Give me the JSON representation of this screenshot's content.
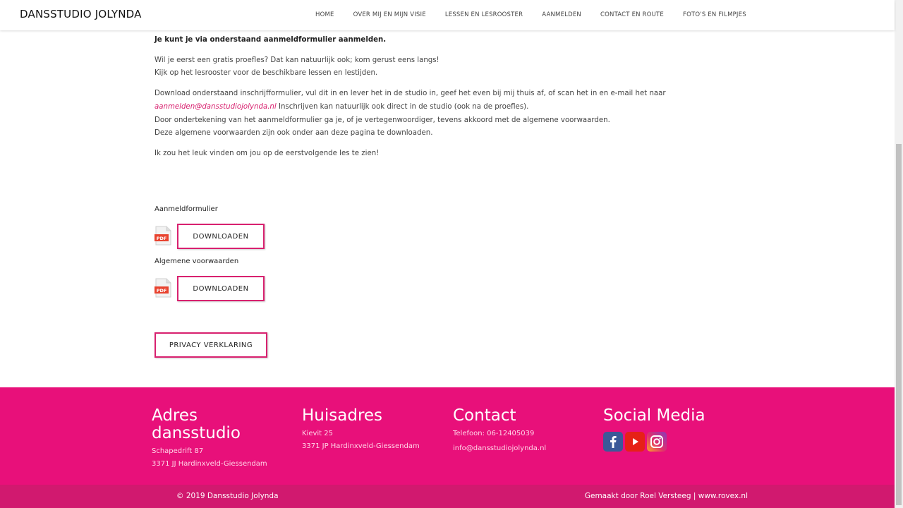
{
  "header": {
    "brand": "DANSSTUDIO JOLYNDA",
    "nav": [
      "HOME",
      "OVER MIJ EN MIJN VISIE",
      "LESSEN EN LESROOSTER",
      "AANMELDEN",
      "CONTACT EN ROUTE",
      "FOTO'S EN FILMPJES"
    ]
  },
  "content": {
    "lead": "Je kunt je via onderstaand aanmeldformulier aanmelden.",
    "p2_line1": "Wil je eerst een gratis proefles? Dat kan natuurlijk ook; kom gerust eens langs!",
    "p2_line2": "Kijk op het lesrooster voor de beschikbare lessen en lestijden.",
    "p3_line1": "Download onderstaand inschrijfformulier, vul dit in en lever het in de studio in, geef het even bij mij thuis af, of scan het in en e-mail het naar",
    "p3_email": "aanmelden@dansstudiojolynda.nl",
    "p3_line2_rest": " Inschrijven kan natuurlijk ook direct in de studio (ook na de proefles).",
    "p3_line3": "Door ondertekening van het aanmeldformulier ga je, of je vertegenwoordiger, tevens akkoord met de algemene voorwaarden.",
    "p3_line4": "Deze algemene voorwaarden zijn ook onder aan deze pagina te downloaden.",
    "p4": "Ik zou het leuk vinden om jou op de eerstvolgende les te zien!"
  },
  "downloads": [
    {
      "label": "Aanmeldformulier",
      "button": "DOWNLOADEN",
      "icon_text": "PDF"
    },
    {
      "label": "Algemene voorwaarden",
      "button": "DOWNLOADEN",
      "icon_text": "PDF"
    }
  ],
  "privacy_button": "PRIVACY VERKLARING",
  "footer": {
    "address_title_1": "Adres",
    "address_title_2": "dansstudio",
    "address_line1": "Schapedrift 87",
    "address_line2": "3371 JJ Hardinxveld-Giessendam",
    "home_title": "Huisadres",
    "home_line1": "Kievit 25",
    "home_line2": "3371 JP Hardinxveld-Giessendam",
    "contact_title": "Contact",
    "contact_phone": "Telefoon: 06-12405039",
    "contact_email": "info@dansstudiojolynda.nl",
    "social_title": "Social Media",
    "social_icons": [
      "facebook-icon",
      "youtube-icon",
      "instagram-icon"
    ]
  },
  "bottombar": {
    "copyright": "© 2019 Dansstudio Jolynda",
    "credit": "Gemaakt door Roel Versteeg | www.rovex.nl"
  },
  "colors": {
    "accent": "#e8107a",
    "bottom_bar": "#d1196f",
    "link": "#d8216f"
  }
}
